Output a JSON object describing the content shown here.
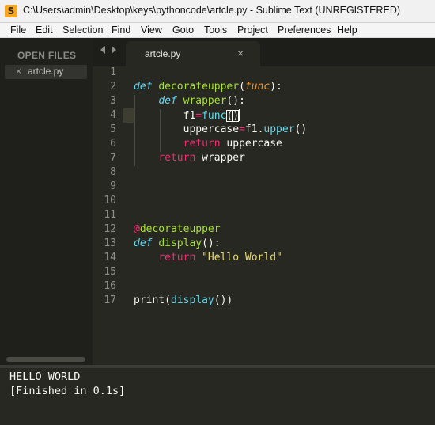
{
  "window": {
    "title": "C:\\Users\\admin\\Desktop\\keys\\pythoncode\\artcle.py - Sublime Text (UNREGISTERED)",
    "icon": "S"
  },
  "menu": [
    "File",
    "Edit",
    "Selection",
    "Find",
    "View",
    "Goto",
    "Tools",
    "Project",
    "Preferences",
    "Help"
  ],
  "sidebar": {
    "heading": "OPEN FILES",
    "files": [
      {
        "close": "×",
        "name": "artcle.py"
      }
    ]
  },
  "tab": {
    "label": "artcle.py",
    "close": "×"
  },
  "editor": {
    "line_numbers": [
      "1",
      "2",
      "3",
      "4",
      "5",
      "6",
      "7",
      "8",
      "9",
      "10",
      "11",
      "12",
      "13",
      "14",
      "15",
      "16",
      "17"
    ],
    "tokens": {
      "def": "def",
      "decorateupper": "decorateupper",
      "func_param": "func",
      "colon": ":",
      "wrapper": "wrapper",
      "parens": "()",
      "f1": "f1",
      "eq": "=",
      "func_call": "func",
      "lparen": "(",
      "rparen": ")",
      "uppercase": "uppercase",
      "dot": ".",
      "upper": "upper",
      "return": "return",
      "decorator": "@decorateupper",
      "display": "display",
      "hello_world": "\"Hello World\"",
      "print": "print",
      "display_call": "display"
    }
  },
  "output": {
    "lines": [
      "HELLO WORLD",
      "[Finished in 0.1s]"
    ]
  },
  "colors": {
    "background": "#272822",
    "keyword": "#66d9ef",
    "function": "#a6e22e",
    "parameter": "#fd971f",
    "operator": "#f92672",
    "string": "#e6db74",
    "line_number": "#8f908a"
  }
}
